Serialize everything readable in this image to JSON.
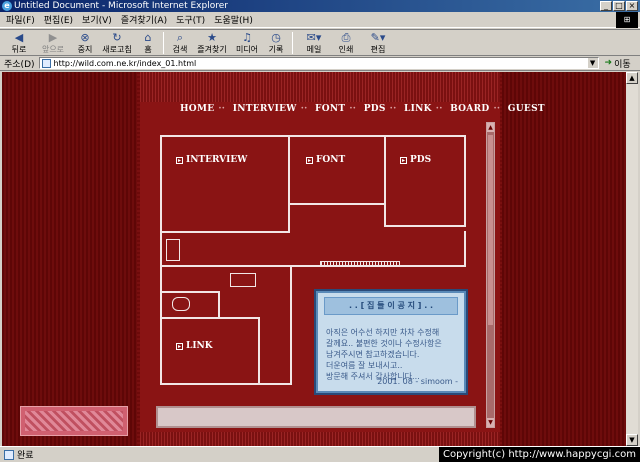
{
  "window": {
    "title": "Untitled Document - Microsoft Internet Explorer"
  },
  "menu": {
    "items": [
      "파일(F)",
      "편집(E)",
      "보기(V)",
      "즐겨찾기(A)",
      "도구(T)",
      "도움말(H)"
    ]
  },
  "toolbar": {
    "back": "뒤로",
    "forward": "앞으로",
    "stop": "중지",
    "refresh": "새로고침",
    "home": "홈",
    "search": "검색",
    "favorites": "즐겨찾기",
    "media": "미디어",
    "history": "기록",
    "mail": "메일",
    "print": "인쇄",
    "edit": "편집"
  },
  "address": {
    "label": "주소(D)",
    "url": "http://wild.com.ne.kr/index_01.html",
    "go": "이동"
  },
  "page": {
    "nav": [
      "HOME",
      "INTERVIEW",
      "FONT",
      "PDS",
      "LINK",
      "BOARD",
      "GUEST"
    ],
    "rooms": {
      "interview": "INTERVIEW",
      "font": "FONT",
      "pds": "PDS",
      "link": "LINK"
    },
    "notice": {
      "heading": ". . [ 집 들 이 공 지 ] . .",
      "lines": [
        "아직은 어수선 하지만 차차 수정해",
        "갈께요.. 불편한 것이나 수정사항은",
        "남겨주시면 참고하겠습니다.",
        "더운여름 잘 보내시고..",
        "방문해 주셔서 감사합니다..."
      ],
      "signature": "2001. 08 - simoom -"
    }
  },
  "status": {
    "text": "완료",
    "watermark": "Copyright(c) http://www.happycgi.com"
  }
}
